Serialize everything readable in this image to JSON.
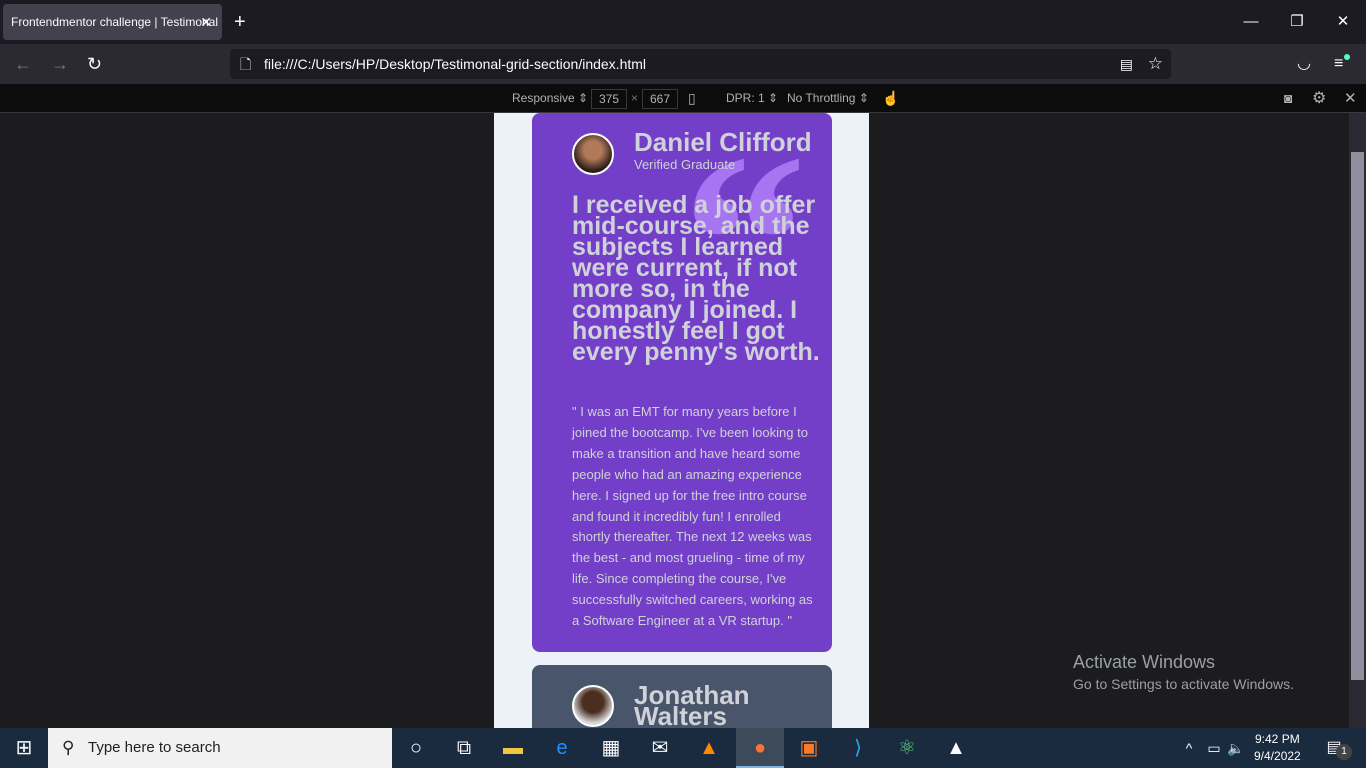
{
  "browser": {
    "tab_title": "Frontendmentor challenge | Testimonal",
    "url": "file:///C:/Users/HP/Desktop/Testimonal-grid-section/index.html"
  },
  "devtools": {
    "device": "Responsive",
    "width": "375",
    "height": "667",
    "dpr": "DPR: 1",
    "throttling": "No Throttling"
  },
  "cards": [
    {
      "name": "Daniel Clifford",
      "role": "Verified Graduate",
      "headline": "I received a job offer mid-course, and the subjects I learned were current, if not more so, in the company I joined. I honestly feel I got every penny's worth.",
      "body": "\" I was an EMT for many years before I joined the bootcamp. I've been looking to make a transition and have heard some people who had an amazing experience here. I signed up for the free intro course and found it incredibly fun! I enrolled shortly thereafter. The next 12 weeks was the best - and most grueling - time of my life. Since completing the course, I've successfully switched careers, working as a Software Engineer at a VR startup. \"",
      "color": "#733fc8"
    },
    {
      "name": "Jonathan Walters",
      "color": "#48556a"
    }
  ],
  "watermark": {
    "title": "Activate Windows",
    "subtitle": "Go to Settings to activate Windows."
  },
  "taskbar": {
    "search_placeholder": "Type here to search",
    "time": "9:42 PM",
    "date": "9/4/2022",
    "notifications": "1"
  }
}
